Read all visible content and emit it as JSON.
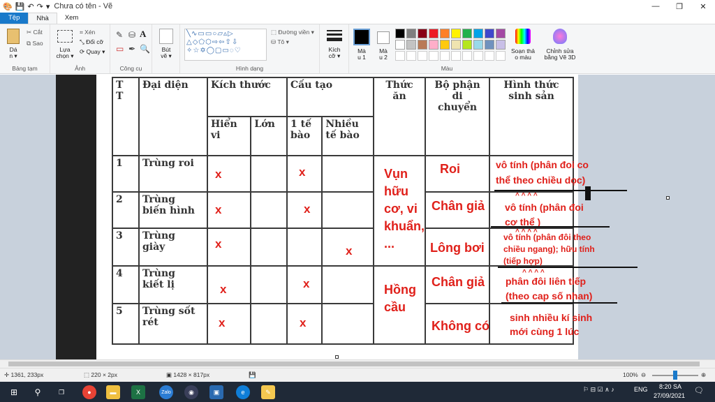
{
  "window": {
    "title": "Chưa có tên - Vẽ"
  },
  "tabs": [
    {
      "label": "Tệp"
    },
    {
      "label": "Nhà"
    },
    {
      "label": "Xem"
    }
  ],
  "ribbon": {
    "clipboard": {
      "paste": "Dá\nn ▾",
      "cut": "Cắt",
      "copy": "Sao",
      "label": "Bảng tạm"
    },
    "image": {
      "select": "Lựa\nchọn ▾",
      "crop": "Xén",
      "resize": "Đổi cỡ",
      "rotate": "Quay ▾",
      "label": "Ảnh"
    },
    "tools": {
      "label": "Công cụ"
    },
    "brushes": {
      "text": "Bút\nvẽ ▾"
    },
    "shapes": {
      "outline": "Đường viền ▾",
      "fill": "Tô ▾",
      "label": "Hình dạng"
    },
    "size": {
      "text": "Kích\ncỡ ▾"
    },
    "color1": {
      "text": "Mà\nu 1"
    },
    "color2": {
      "text": "Mà\nu 2"
    },
    "colors": {
      "label": "Màu",
      "palette": [
        "#000000",
        "#7f7f7f",
        "#880015",
        "#ed1c24",
        "#ff7f27",
        "#fff200",
        "#22b14c",
        "#00a2e8",
        "#3f48cc",
        "#a349a4",
        "#ffffff",
        "#c3c3c3",
        "#b97a57",
        "#ffaec9",
        "#ffc90e",
        "#efe4b0",
        "#b5e61d",
        "#99d9ea",
        "#7092be",
        "#c8bfe7"
      ]
    },
    "edit_colors": {
      "text": "Soạn thả\no màu"
    },
    "paint3d": {
      "text": "Chỉnh sửa\nbằng Vẽ 3D"
    }
  },
  "table": {
    "h_tt": "T\nT",
    "h_representative": "Đại diện",
    "h_size": "Kích thước",
    "h_structure": "Cấu tạo",
    "h_food": "Thức\năn",
    "h_movement": "Bộ phận\ndi\nchuyển",
    "h_reproduction": "Hình thức\nsinh sản",
    "sub_micro": "Hiển\nvi",
    "sub_large": "Lớn",
    "sub_one_cell": "1 tế\nbào",
    "sub_many_cell": "Nhiều\ntế bào",
    "rows": [
      {
        "n": "1",
        "name": "Trùng roi"
      },
      {
        "n": "2",
        "name": "Trùng\nbiến hình"
      },
      {
        "n": "3",
        "name": "Trùng\ngiày"
      },
      {
        "n": "4",
        "name": "Trùng\nkiết lị"
      },
      {
        "n": "5",
        "name": "Trùng sốt\nrét"
      }
    ]
  },
  "annotations": {
    "mark": "x",
    "food_1": "Vụn\nhữu\ncơ, vi\nkhuẩn,\n...",
    "food_2": "Hồng\ncầu",
    "move_1": "Roi",
    "move_2": "Chân giả",
    "move_3": "Lông bơi",
    "move_4": "Chân giả",
    "move_5": "Không có",
    "rep_1": "vô tính (phân đoi co\nthể theo chiều dọc)",
    "rep_2": "vô tính (phân đoi\ncơ thể )",
    "rep_3": "vô tính (phân đôi theo\nchiều ngang); hữu tính\n(tiếp hợp)",
    "rep_4": "phân đôi liên tiếp\n(theo cap số nhan)",
    "rep_5": "sinh nhiều kí sinh\nmới cùng 1 lúc"
  },
  "status": {
    "cursor": "1361, 233px",
    "selection": "220 × 2px",
    "canvas": "1428 × 817px",
    "zoom": "100%"
  },
  "taskbar": {
    "lang": "ENG",
    "time": "8:20 SA",
    "date": "27/09/2021"
  }
}
